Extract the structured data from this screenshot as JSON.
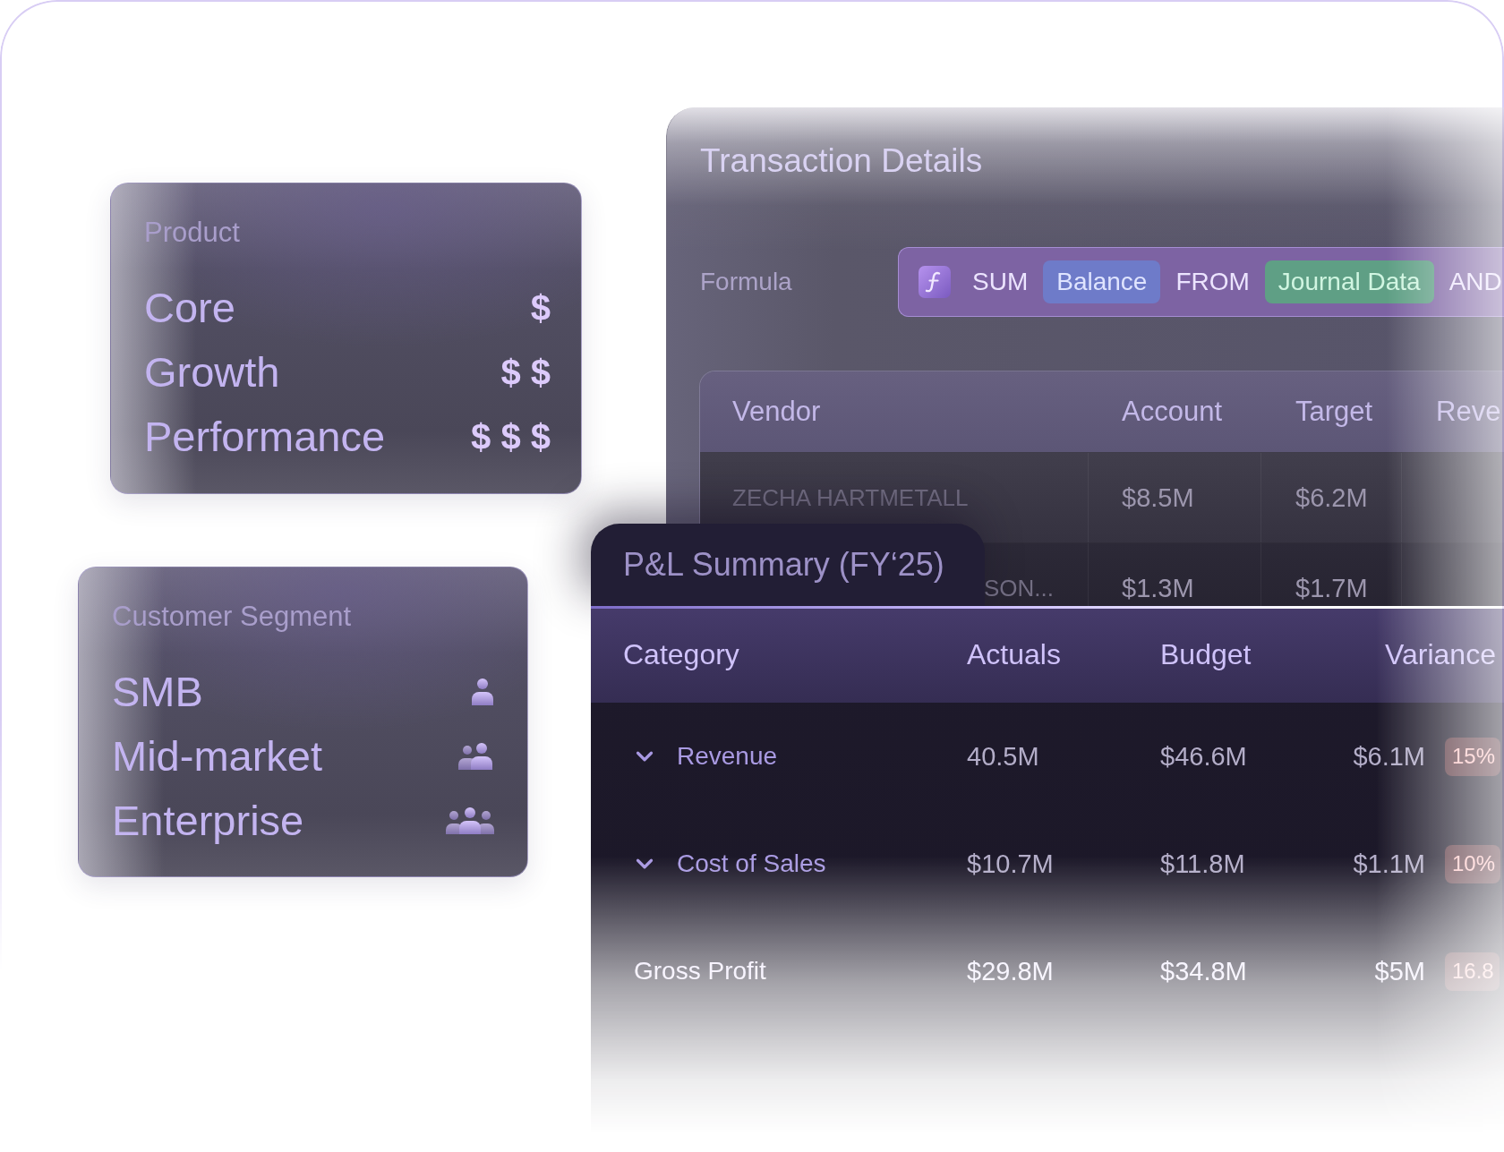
{
  "product_card": {
    "title": "Product",
    "options": [
      {
        "label": "Core",
        "price": "$"
      },
      {
        "label": "Growth",
        "price": "$ $"
      },
      {
        "label": "Performance",
        "price": "$ $ $"
      }
    ]
  },
  "segment_card": {
    "title": "Customer Segment",
    "options": [
      {
        "label": "SMB"
      },
      {
        "label": "Mid-market"
      },
      {
        "label": "Enterprise"
      }
    ]
  },
  "transaction_details": {
    "title": "Transaction Details",
    "formula": {
      "label": "Formula",
      "tokens": [
        {
          "kind": "keyword",
          "text": "SUM"
        },
        {
          "kind": "field",
          "text": "Balance"
        },
        {
          "kind": "keyword",
          "text": "FROM"
        },
        {
          "kind": "source",
          "text": "Journal Data"
        },
        {
          "kind": "keyword",
          "text": "AND"
        }
      ]
    },
    "table": {
      "columns": [
        "Vendor",
        "Account",
        "Target",
        "Reve"
      ],
      "rows": [
        {
          "vendor": "ZECHA HARTMETALL",
          "account": "$8.5M",
          "target": "$6.2M"
        },
        {
          "vendor": "SON...",
          "account": "$1.3M",
          "target": "$1.7M"
        }
      ]
    }
  },
  "pl_summary": {
    "title": "P&L Summary (FY‘25)",
    "columns": [
      "Category",
      "Actuals",
      "Budget",
      "Variance"
    ],
    "rows": [
      {
        "kind": "group",
        "category": "Revenue",
        "actuals": "40.5M",
        "budget": "$46.6M",
        "variance": "$6.1M",
        "change": "15%"
      },
      {
        "kind": "group",
        "category": "Cost of Sales",
        "actuals": "$10.7M",
        "budget": "$11.8M",
        "variance": "$1.1M",
        "change": "10%"
      },
      {
        "kind": "subtotal",
        "category": "Gross Profit",
        "actuals": "$29.8M",
        "budget": "$34.8M",
        "variance": "$5M",
        "change": "16.8"
      }
    ]
  }
}
